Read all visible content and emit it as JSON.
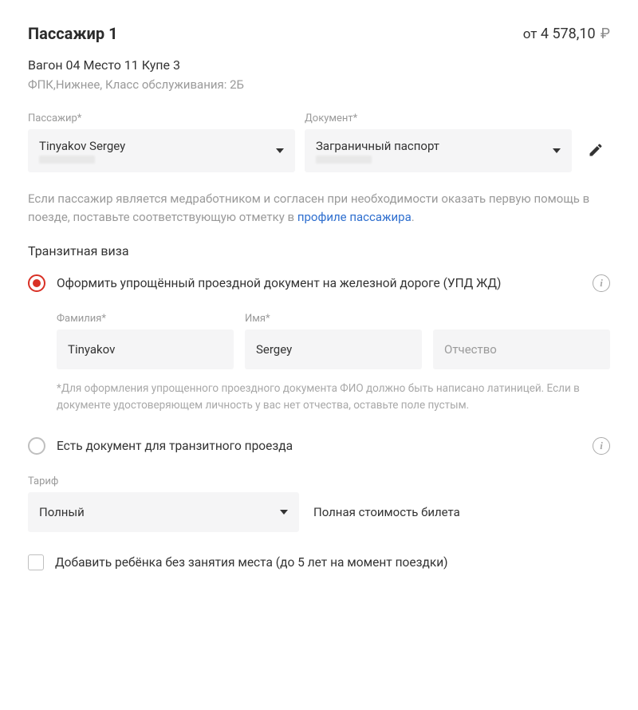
{
  "header": {
    "title": "Пассажир 1",
    "price_from": "от",
    "price_amount": "4 578,10",
    "price_currency": "₽"
  },
  "seat": {
    "line1": "Вагон 04 Место 11 Купе 3",
    "line2": "ФПК,Нижнее,  Класс обслуживания: 2Б"
  },
  "top_fields": {
    "passenger_label": "Пассажир*",
    "passenger_value": "Tinyakov Sergey",
    "document_label": "Документ*",
    "document_value": "Заграничный паспорт"
  },
  "helper": {
    "text_before": "Если пассажир является медработником и согласен при необходимости оказать первую помощь в поезде, поставьте соответствующую отметку в ",
    "link": "профиле пассажира",
    "text_after": "."
  },
  "transit": {
    "section_title": "Транзитная виза",
    "option1_label": "Оформить упрощённый проездной документ на железной дороге (УПД ЖД)",
    "option2_label": "Есть документ для транзитного проезда",
    "fields": {
      "surname_label": "Фамилия*",
      "surname_value": "Tinyakov",
      "name_label": "Имя*",
      "name_value": "Sergey",
      "patronymic_placeholder": "Отчество"
    },
    "note": "*Для оформления упрощенного проездного документа ФИО должно быть написано латиницей. Если в документе удостоверяющем личность у вас нет отчества, оставьте поле пустым."
  },
  "tariff": {
    "label": "Тариф",
    "value": "Полный",
    "description": "Полная стоимость билета"
  },
  "add_child": {
    "label": "Добавить ребёнка без занятия места (до 5 лет на момент поездки)"
  }
}
